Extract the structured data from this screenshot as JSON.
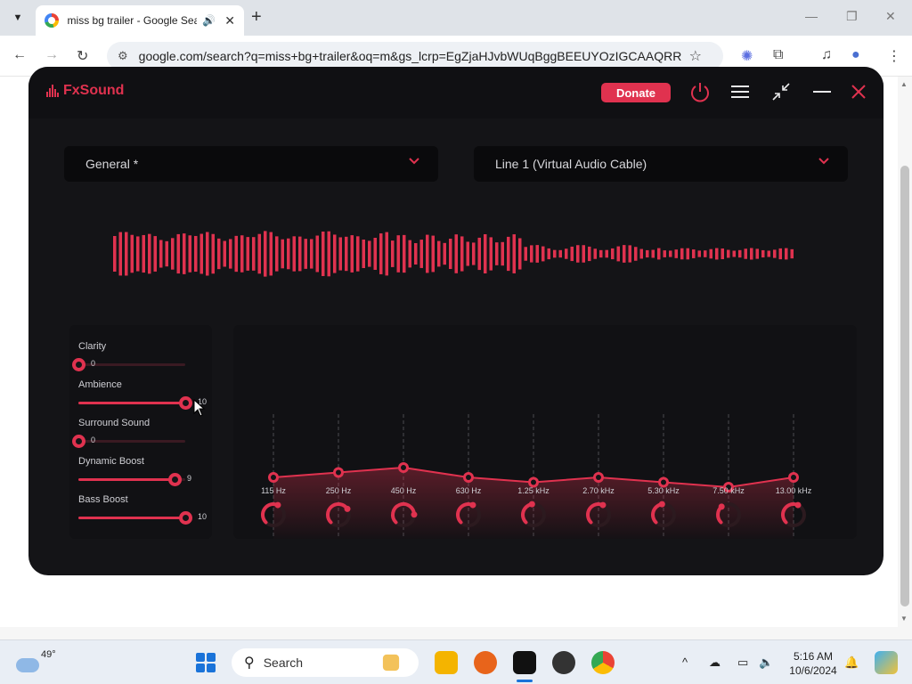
{
  "browser": {
    "tab_title": "miss bg trailer - Google Sea",
    "url": "google.com/search?q=miss+bg+trailer&oq=m&gs_lcrp=EgZjaHJvbWUqBggBEEUYOzIGCAAQRR..."
  },
  "fxsound": {
    "logo": "FxSound",
    "donate_label": "Donate",
    "preset": "General *",
    "output_device": "Line 1 (Virtual Audio Cable)",
    "effects": [
      {
        "label": "Clarity",
        "value": "0",
        "level": 0
      },
      {
        "label": "Ambience",
        "value": "10",
        "level": 1.0
      },
      {
        "label": "Surround Sound",
        "value": "0",
        "level": 0
      },
      {
        "label": "Dynamic Boost",
        "value": "9",
        "level": 0.9
      },
      {
        "label": "Bass Boost",
        "value": "10",
        "level": 1.0
      }
    ],
    "eq_bands": [
      {
        "freq": "115 Hz",
        "gain": 0.0
      },
      {
        "freq": "250 Hz",
        "gain": 0.1
      },
      {
        "freq": "450 Hz",
        "gain": 0.2
      },
      {
        "freq": "630 Hz",
        "gain": 0.0
      },
      {
        "freq": "1.25 kHz",
        "gain": -0.1
      },
      {
        "freq": "2.70 kHz",
        "gain": 0.0
      },
      {
        "freq": "5.30 kHz",
        "gain": -0.1
      },
      {
        "freq": "7.50 kHz",
        "gain": -0.2
      },
      {
        "freq": "13.00 kHz",
        "gain": 0.0
      }
    ],
    "accent_color": "#e0324f"
  },
  "taskbar": {
    "temperature": "49°",
    "search_placeholder": "Search",
    "time": "5:16 AM",
    "date": "10/6/2024"
  }
}
